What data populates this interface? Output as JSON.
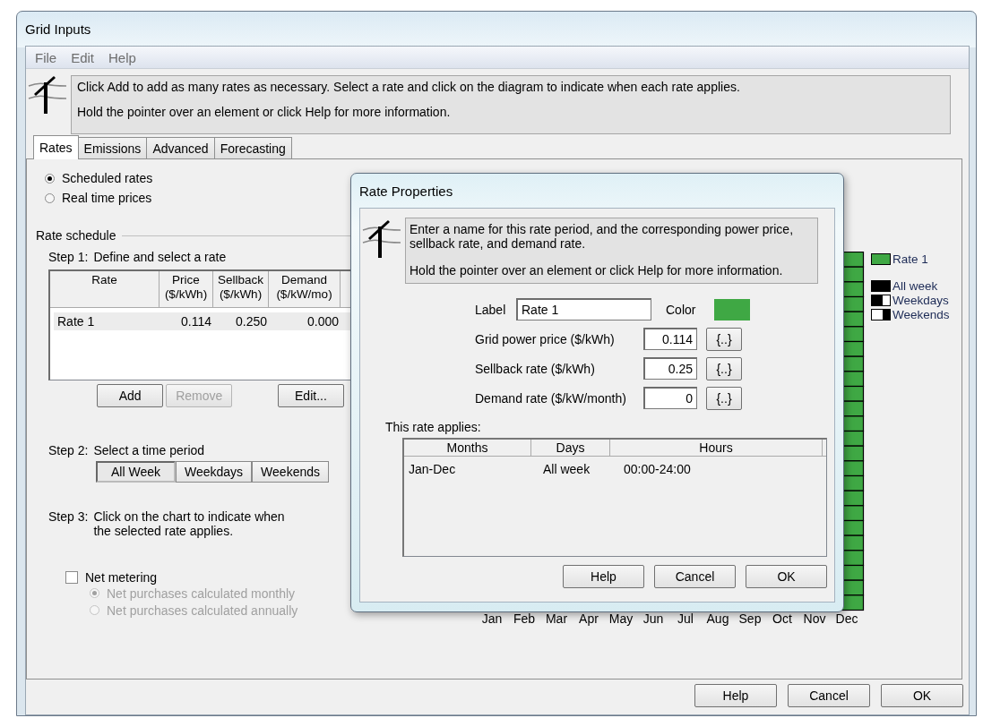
{
  "window": {
    "title": "Grid Inputs"
  },
  "menu": [
    "File",
    "Edit",
    "Help"
  ],
  "info": [
    "Click Add to add as many rates as necessary.  Select a rate and click on the diagram to indicate when each rate applies.",
    "Hold the pointer over an element or click Help for more information."
  ],
  "tabs": [
    {
      "label": "Rates",
      "selected": true
    },
    {
      "label": "Emissions",
      "selected": false
    },
    {
      "label": "Advanced",
      "selected": false
    },
    {
      "label": "Forecasting",
      "selected": false
    }
  ],
  "rate_mode": [
    {
      "label": "Scheduled rates",
      "selected": true
    },
    {
      "label": "Real time prices",
      "selected": false
    }
  ],
  "rate_schedule": {
    "title": "Rate schedule",
    "step1": {
      "number": "Step 1:",
      "text": "Define and select a rate"
    },
    "columns": [
      {
        "title": "Rate"
      },
      {
        "title": "Price",
        "unit": "($/kWh)"
      },
      {
        "title": "Sellback",
        "unit": "($/kWh)"
      },
      {
        "title": "Demand",
        "unit": "($/kW/mo)"
      }
    ],
    "rows": [
      {
        "cells": [
          "Rate 1",
          "0.114",
          "0.250",
          "0.000"
        ],
        "selected": true
      }
    ],
    "buttons": [
      {
        "label": "Add",
        "disabled": false
      },
      {
        "label": "Remove",
        "disabled": true
      },
      {
        "label": "Edit...",
        "disabled": false
      }
    ],
    "step2": {
      "number": "Step 2:",
      "text": "Select a time period"
    },
    "periods": [
      {
        "label": "All Week",
        "selected": true
      },
      {
        "label": "Weekdays",
        "selected": false
      },
      {
        "label": "Weekends",
        "selected": false
      }
    ],
    "step3": {
      "number": "Step 3:",
      "text": [
        "Click on the chart to indicate when",
        "the selected rate applies."
      ]
    }
  },
  "net_metering": {
    "label": "Net metering",
    "checked": false,
    "options": [
      {
        "label": "Net purchases calculated monthly",
        "selected": true,
        "disabled": true
      },
      {
        "label": "Net purchases calculated annually",
        "selected": false,
        "disabled": true
      }
    ]
  },
  "chart": {
    "months": [
      "Jan",
      "Feb",
      "Mar",
      "Apr",
      "May",
      "Jun",
      "Jul",
      "Aug",
      "Sep",
      "Oct",
      "Nov",
      "Dec"
    ],
    "rates": [
      {
        "label": "Rate 1",
        "color": "#3fa844"
      }
    ],
    "day_types": [
      {
        "label": "All week",
        "kind": "all"
      },
      {
        "label": "Weekdays",
        "kind": "weekdays"
      },
      {
        "label": "Weekends",
        "kind": "weekends"
      }
    ]
  },
  "buttons": [
    "Help",
    "Cancel",
    "OK"
  ],
  "dialog": {
    "title": "Rate Properties",
    "info": [
      "Enter a name for this rate period, and the corresponding power price, sellback rate, and demand rate.",
      "Hold the pointer over an element or click Help for more information."
    ],
    "label_field": {
      "label": "Label",
      "value": "Rate 1"
    },
    "color": {
      "label": "Color",
      "color": "#3fa844"
    },
    "fields": [
      {
        "label": "Grid power price ($/kWh)",
        "value": "0.114",
        "button": "{..}"
      },
      {
        "label": "Sellback rate ($/kWh)",
        "value": "0.25",
        "button": "{..}"
      },
      {
        "label": "Demand rate ($/kW/month)",
        "value": "0",
        "button": "{..}"
      }
    ],
    "applies_label": "This rate applies:",
    "columns": [
      "Months",
      "Days",
      "Hours"
    ],
    "rows": [
      [
        "Jan-Dec",
        "All week",
        "00:00-24:00"
      ]
    ],
    "buttons": [
      "Help",
      "Cancel",
      "OK"
    ]
  }
}
